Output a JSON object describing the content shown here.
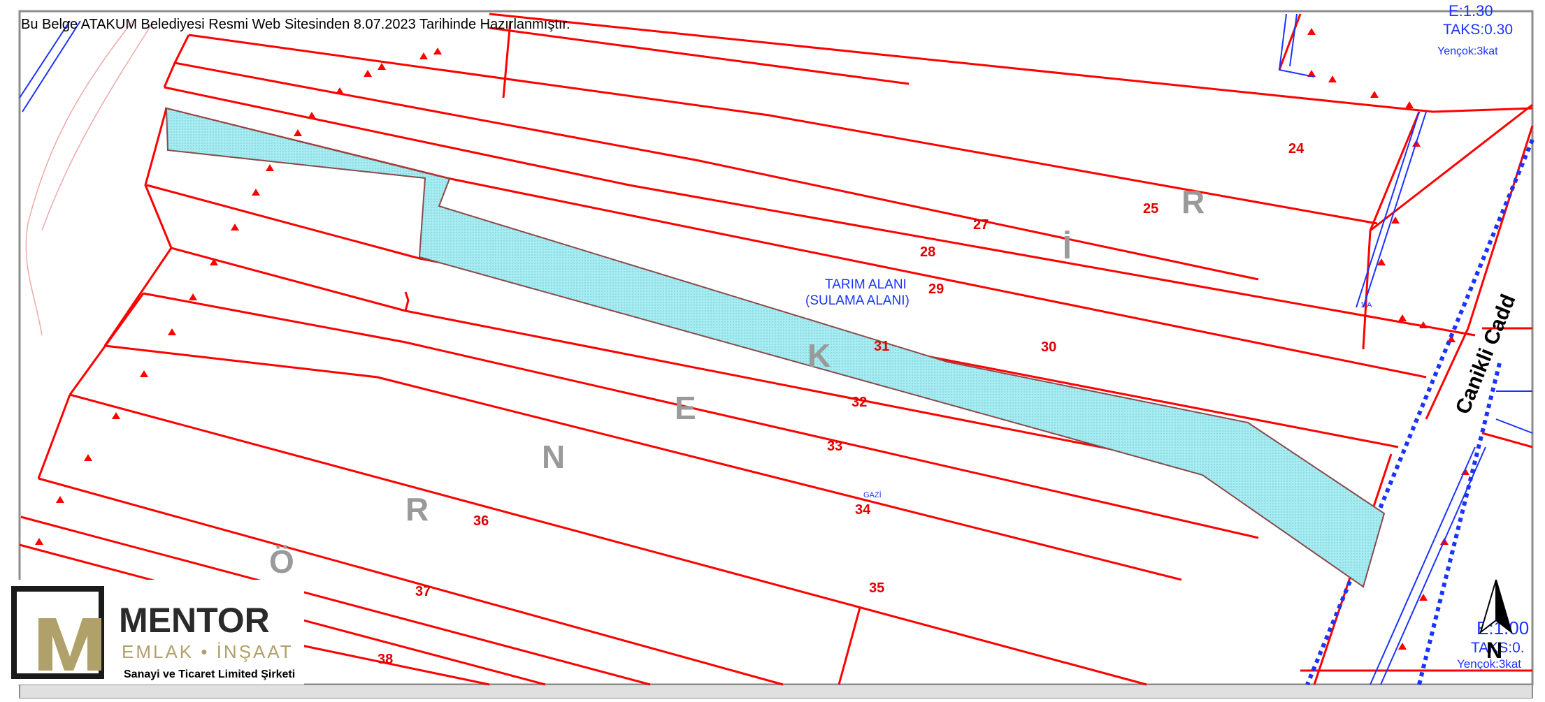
{
  "header": {
    "text": "Bu Belge ATAKUM Belediyesi Resmi Web Sitesinden 8.07.2023 Tarihinde Hazırlanmıştır."
  },
  "zoning_top_right": {
    "line1": "E:1.30",
    "line2": "TAKS:0.30",
    "line3": "Yençok:3kat"
  },
  "zoning_bottom_right": {
    "line1": "E:1.00",
    "line2": "TAKS:0.",
    "line3": "Yençok:3kat"
  },
  "area_label": {
    "line1": "TARIM ALANI",
    "line2": "(SULAMA ALANI)"
  },
  "street_label": "Canikli Cadd",
  "small_label_1": "GAZİ",
  "small_label_2": "1/A",
  "district_letters": [
    "Ö",
    "R",
    "N",
    "E",
    "K",
    "İ",
    "R"
  ],
  "parcels": [
    "24",
    "25",
    "27",
    "28",
    "29",
    "30",
    "31",
    "32",
    "33",
    "34",
    "35",
    "36",
    "37",
    "38"
  ],
  "north_label": "N",
  "logo": {
    "name": "MENTOR",
    "line2": "EMLAK • İNŞAAT",
    "line3": "Sanayi ve Ticaret Limited Şirketi"
  },
  "colors": {
    "parcel_line": "#ff0000",
    "highlight_fill": "#a8ecf2",
    "map_blue": "#1a33ff",
    "logo_gold": "#b0a06a"
  }
}
